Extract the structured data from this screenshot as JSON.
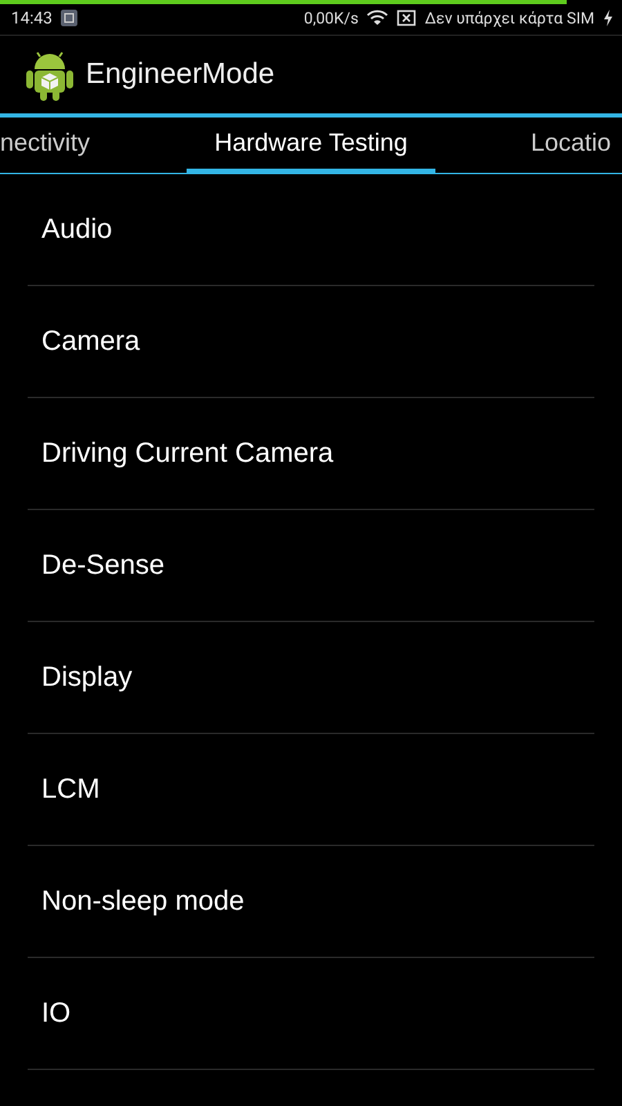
{
  "status_bar": {
    "time": "14:43",
    "speed": "0,00K/s",
    "carrier": "Δεν υπάρχει κάρτα SIM",
    "progress": {
      "level": 0.91
    }
  },
  "app_bar": {
    "title": "EngineerMode"
  },
  "tabs": [
    {
      "label": "nectivity",
      "selected": false
    },
    {
      "label": "Hardware Testing",
      "selected": true
    },
    {
      "label": "Locatio",
      "selected": false
    }
  ],
  "items": [
    "Audio",
    "Camera",
    "Driving Current Camera",
    "De-Sense",
    "Display",
    "LCM",
    "Non-sleep mode",
    "IO"
  ]
}
